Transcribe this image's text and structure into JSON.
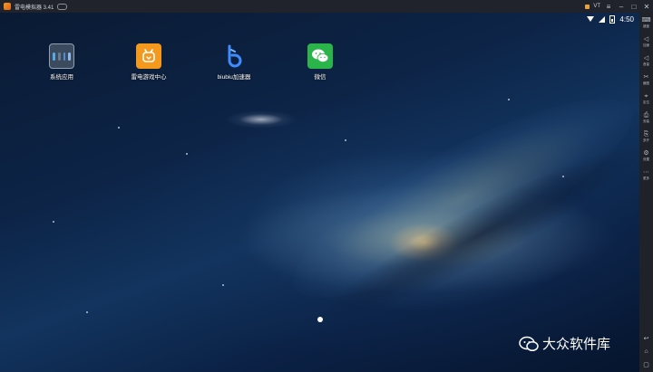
{
  "titlebar": {
    "title": "雷电模拟器 3.41",
    "vt": "VT",
    "icons": [
      "minimize-icon",
      "maximize-icon",
      "close-icon"
    ]
  },
  "statusbar": {
    "time": "4:50"
  },
  "apps": [
    {
      "label": "系统应用",
      "icon": "folder-icon"
    },
    {
      "label": "雷电游戏中心",
      "icon": "game-center-icon"
    },
    {
      "label": "biubiu加速器",
      "icon": "biubiu-icon"
    },
    {
      "label": "微信",
      "icon": "wechat-icon"
    }
  ],
  "sidebar": {
    "items": [
      {
        "glyph": "⌨",
        "label": "键盘"
      },
      {
        "glyph": "◁",
        "label": "加速"
      },
      {
        "glyph": "◁",
        "label": "音量"
      },
      {
        "glyph": "✂",
        "label": "截图"
      },
      {
        "glyph": "⌖",
        "label": "定位"
      },
      {
        "glyph": "⎙",
        "label": "安装"
      },
      {
        "glyph": "⎘",
        "label": "多开"
      },
      {
        "glyph": "⚙",
        "label": "设置"
      },
      {
        "glyph": "⋯",
        "label": "更多"
      }
    ],
    "nav": [
      "↩",
      "⌂",
      "▢"
    ]
  },
  "watermark": {
    "text": "大众软件库"
  }
}
